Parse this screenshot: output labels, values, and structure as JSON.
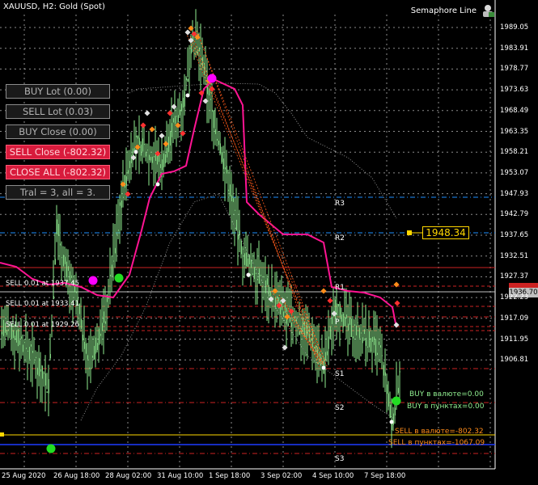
{
  "chart_title": "XAUUSD, H2:  Gold (Spot)",
  "indicator_name": "Semaphore Line",
  "indicator_icon": "trader-icon",
  "panel": {
    "buy_lot": "BUY Lot (0.00)",
    "sell_lot": "SELL Lot (0.03)",
    "buy_close": "BUY Close (0.00)",
    "sell_close": "SELL Close (-802.32)",
    "close_all": "CLOSE ALL (-802.32)",
    "tral": "Tral = 3, all = 3."
  },
  "orders": [
    {
      "text": "SELL 0.01 at 1937.45"
    },
    {
      "text": "SELL 0.01 at 1933.41"
    },
    {
      "text": "SELL 0.01 at 1929.26"
    }
  ],
  "levels": {
    "r3": "R3",
    "r2": "R2",
    "r1": "R1",
    "p": "P",
    "s1": "S1",
    "s2": "S2",
    "s3": "S3"
  },
  "stats": {
    "buy_currency": "BUY в валюте=0.00",
    "buy_points": "BUY в пунктах=0.00",
    "sell_currency": "SELL в валюте=-802.32",
    "sell_points": "SELL в пунктах=-1067.09"
  },
  "current_price": "1948.34",
  "price_tag_red": "",
  "price_tag_gray": "1936.70",
  "price_axis": [
    "1989.05",
    "1983.91",
    "1978.77",
    "1973.63",
    "1968.49",
    "1963.35",
    "1958.21",
    "1953.07",
    "1947.93",
    "1942.79",
    "1937.65",
    "1932.51",
    "1927.37",
    "1922.23",
    "1917.09",
    "1911.95",
    "1906.81"
  ],
  "time_axis": [
    "25 Aug 2020",
    "26 Aug 18:00",
    "28 Aug 02:00",
    "31 Aug 10:00",
    "1 Sep 18:00",
    "3 Sep 02:00",
    "4 Sep 10:00",
    "7 Sep 18:00"
  ],
  "colors": {
    "candle": "#90ee90",
    "ma_line": "#ff1493",
    "grid": "#ffffff",
    "red_level": "#cc2222",
    "blue_level": "#1e90ff",
    "current_price": "#ffd700"
  }
}
